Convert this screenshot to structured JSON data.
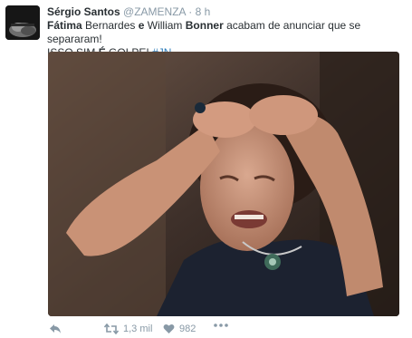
{
  "tweet": {
    "display_name": "Sérgio Santos",
    "handle": "@ZAMENZA",
    "separator": "·",
    "timestamp": "8 h",
    "text": {
      "bold1": "Fátima",
      "t1": " Bernardes ",
      "bold2": "e",
      "t2": " William ",
      "bold3": "Bonner",
      "t3": " acabam de anunciar que se separaram!",
      "line2_a": "ISSO SIM ",
      "line2_bold": "É",
      "line2_b": " GOLPE! ",
      "hashtag": "#JN"
    },
    "actions": {
      "retweet_count": "1,3 mil",
      "like_count": "982"
    }
  },
  "icons": {
    "reply": "reply-icon",
    "retweet": "retweet-icon",
    "like": "heart-icon",
    "more": "more-dots-icon"
  },
  "colors": {
    "link": "#2b7bb9",
    "muted": "#8899a6",
    "text": "#292f33"
  }
}
